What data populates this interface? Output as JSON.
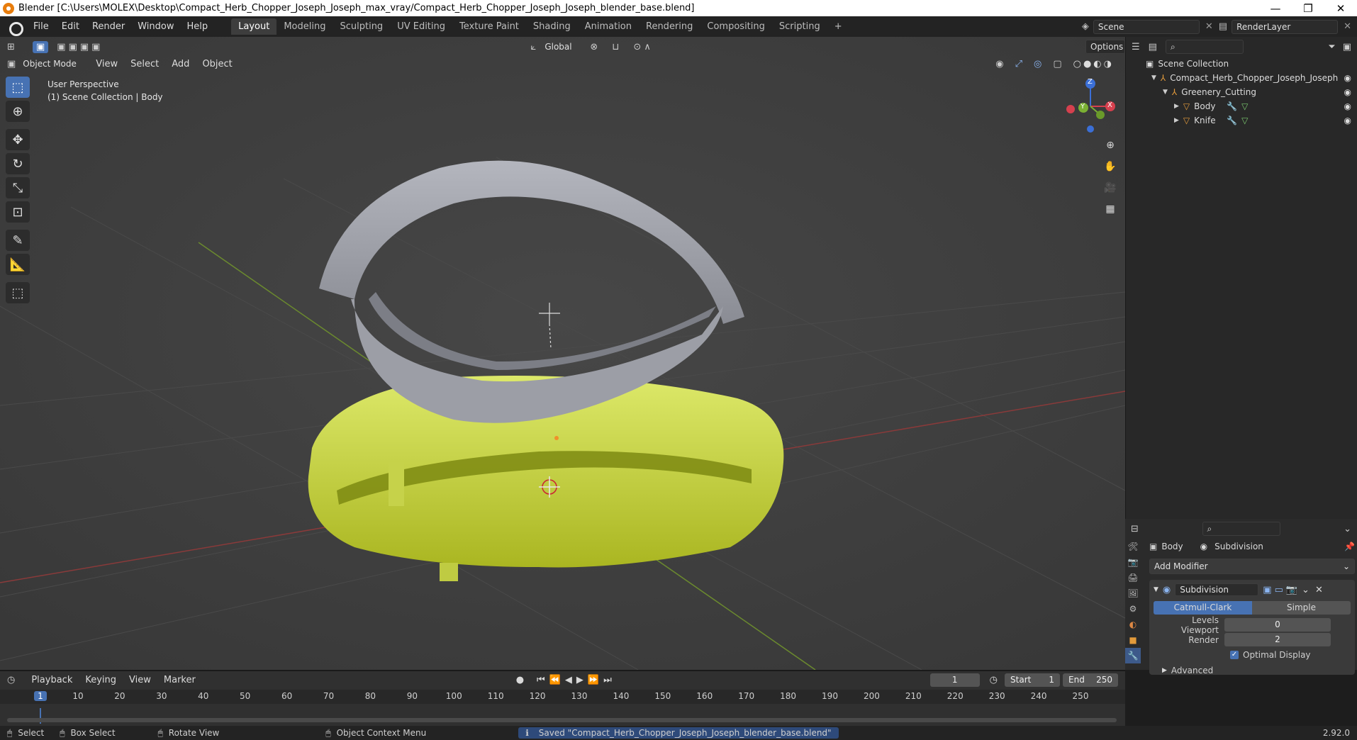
{
  "window": {
    "title": "Blender [C:\\Users\\MOLEX\\Desktop\\Compact_Herb_Chopper_Joseph_Joseph_max_vray/Compact_Herb_Chopper_Joseph_Joseph_blender_base.blend]",
    "minimize": "—",
    "maximize": "❐",
    "close": "✕"
  },
  "menu": [
    "File",
    "Edit",
    "Render",
    "Window",
    "Help"
  ],
  "workspaces": [
    "Layout",
    "Modeling",
    "Sculpting",
    "UV Editing",
    "Texture Paint",
    "Shading",
    "Animation",
    "Rendering",
    "Compositing",
    "Scripting"
  ],
  "active_workspace": "Layout",
  "add_workspace": "+",
  "scene": {
    "label": "Scene",
    "render_layer": "RenderLayer"
  },
  "tool_header": {
    "orientation": "Global",
    "options": "Options"
  },
  "viewport_header": {
    "mode": "Object Mode",
    "menus": [
      "View",
      "Select",
      "Add",
      "Object"
    ]
  },
  "viewport": {
    "line1": "User Perspective",
    "line2": "(1) Scene Collection | Body"
  },
  "gizmo": {
    "x": "X",
    "y": "Y",
    "z": "Z"
  },
  "outliner": {
    "root": "Scene Collection",
    "items": [
      {
        "label": "Compact_Herb_Chopper_Joseph_Joseph",
        "depth": 1,
        "expanded": true
      },
      {
        "label": "Greenery_Cutting",
        "depth": 2,
        "expanded": true
      },
      {
        "label": "Body",
        "depth": 3,
        "expanded": false
      },
      {
        "label": "Knife",
        "depth": 3,
        "expanded": false
      }
    ]
  },
  "properties": {
    "object": "Body",
    "modifier_tab": "Subdivision",
    "add_modifier": "Add Modifier",
    "modifier_name": "Subdivision",
    "type_a": "Catmull-Clark",
    "type_b": "Simple",
    "levels_viewport_label": "Levels Viewport",
    "levels_viewport": "0",
    "render_label": "Render",
    "render": "2",
    "optimal_display": "Optimal Display",
    "advanced": "Advanced"
  },
  "timeline": {
    "menus": [
      "Playback",
      "Keying",
      "View",
      "Marker"
    ],
    "current_frame": "1",
    "start_label": "Start",
    "start": "1",
    "end_label": "End",
    "end": "250",
    "ticks": [
      "1",
      "10",
      "20",
      "30",
      "40",
      "50",
      "60",
      "70",
      "80",
      "90",
      "100",
      "110",
      "120",
      "130",
      "140",
      "150",
      "160",
      "170",
      "180",
      "190",
      "200",
      "210",
      "220",
      "230",
      "240",
      "250"
    ]
  },
  "status": {
    "select": "Select",
    "box_select": "Box Select",
    "rotate_view": "Rotate View",
    "context_menu": "Object Context Menu",
    "message": "Saved \"Compact_Herb_Chopper_Joseph_Joseph_blender_base.blend\"",
    "version": "2.92.0"
  }
}
